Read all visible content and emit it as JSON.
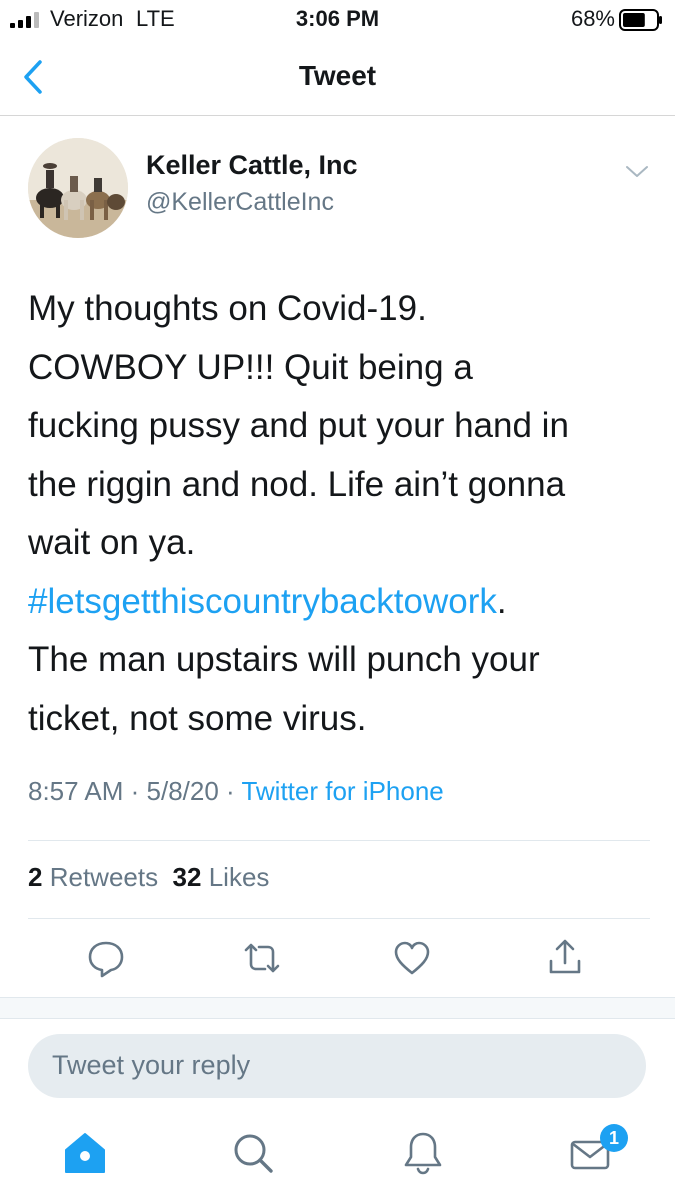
{
  "status_bar": {
    "carrier": "Verizon",
    "network": "LTE",
    "time": "3:06 PM",
    "battery": "68%",
    "battery_level": 0.68
  },
  "nav": {
    "title": "Tweet",
    "back_icon": "chevron-left-icon"
  },
  "author": {
    "display_name": "Keller Cattle, Inc",
    "handle": "@KellerCattleInc"
  },
  "tweet": {
    "line1": "My thoughts on Covid-19.",
    "line2": "COWBOY UP!!!  Quit being a",
    "line3": "fucking pussy and put your hand in",
    "line4": "the riggin and nod.  Life ain’t gonna",
    "line5": "wait on ya.",
    "hashtag": "#letsgetthiscountrybacktowork",
    "hashtag_suffix": ".",
    "line7": "The man upstairs will punch your",
    "line8": "ticket, not some virus."
  },
  "meta": {
    "time": "8:57 AM",
    "date": "5/8/20",
    "separator": " · ",
    "source": "Twitter for iPhone"
  },
  "stats": {
    "retweets_count": "2",
    "retweets_label": "Retweets",
    "likes_count": "32",
    "likes_label": "Likes"
  },
  "actions": [
    "reply-icon",
    "retweet-icon",
    "like-icon",
    "share-icon"
  ],
  "reply": {
    "placeholder": "Tweet your reply"
  },
  "tabbar": {
    "tabs": [
      "home-icon",
      "search-icon",
      "notifications-icon",
      "messages-icon"
    ],
    "messages_badge": "1"
  },
  "colors": {
    "accent": "#1da1f2",
    "text": "#14171a",
    "secondary": "#657786",
    "divider": "#e1e8ed"
  }
}
